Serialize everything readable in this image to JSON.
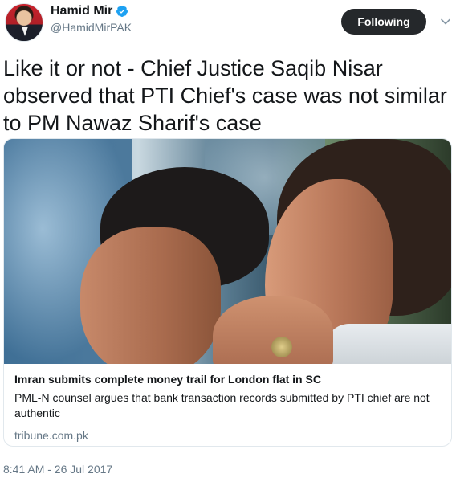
{
  "author": {
    "display_name": "Hamid Mir",
    "handle": "@HamidMirPAK",
    "verified_icon": "verified-badge-icon",
    "verified_color": "#1da1f2"
  },
  "follow_button": {
    "label": "Following",
    "color": "#25282b"
  },
  "menu_icon": "chevron-down-icon",
  "tweet": {
    "text": "Like it or not - Chief Justice Saqib Nisar observed that PTI Chief's case was not similar to PM Nawaz Sharif's case"
  },
  "card": {
    "title": "Imran submits complete money trail for London flat in SC",
    "description": "PML-N counsel argues that bank transaction records submitted by PTI chief are not authentic",
    "domain": "tribune.com.pk"
  },
  "timestamp": "8:41 AM - 26 Jul 2017"
}
